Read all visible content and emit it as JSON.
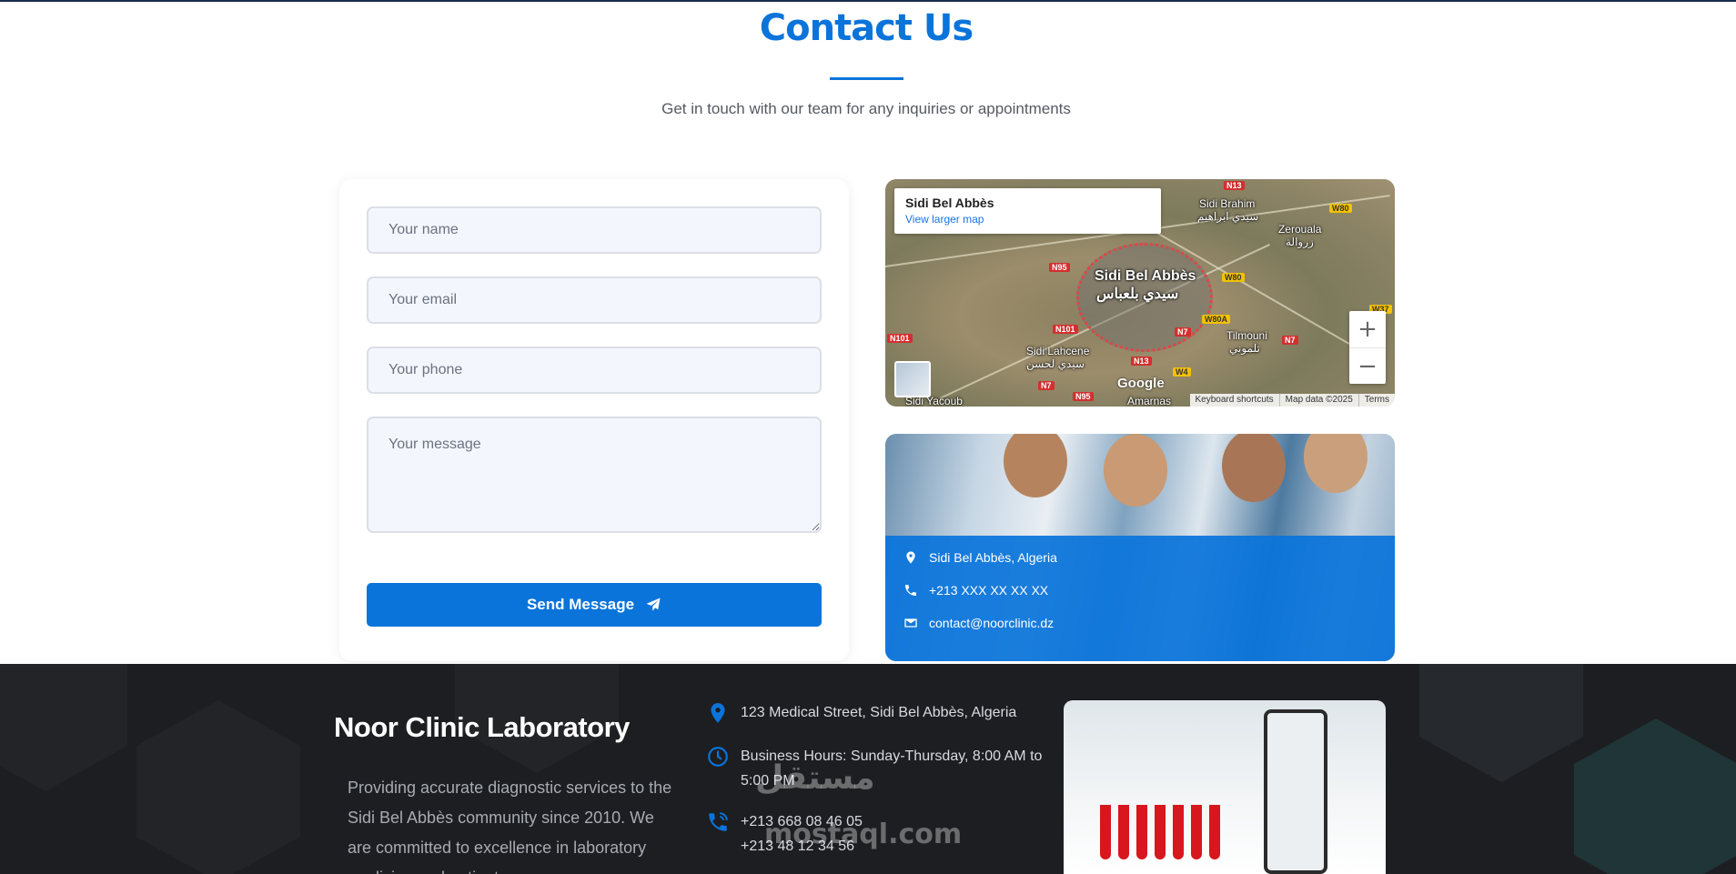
{
  "header": {
    "title": "Contact Us",
    "subtitle": "Get in touch with our team for any inquiries or appointments"
  },
  "form": {
    "name_placeholder": "Your name",
    "email_placeholder": "Your email",
    "phone_placeholder": "Your phone",
    "message_placeholder": "Your message",
    "send_label": "Send Message",
    "send_icon": "paper-plane-icon"
  },
  "map": {
    "place_name": "Sidi Bel Abbès",
    "view_larger": "View larger map",
    "city_label": "Sidi Bel Abbès",
    "city_label_ar": "سيدي بلعباس",
    "labels": {
      "sidi_brahim": "Sidi Brahim",
      "sidi_brahim_ar": "سيدي ابراهيم",
      "zeroua": "Zerouala",
      "zeroua_ar": "زروالة",
      "sidi_lahcene": "Sidi Lahcene",
      "sidi_lahcene_ar": "سيدي لحسن",
      "tilmouni": "Tilmouni",
      "tilmouni_ar": "تلموني",
      "sidi_yacoub": "Sidi Yacoub",
      "amarnas": "Amarnas"
    },
    "roads": [
      "N13",
      "N95",
      "N101",
      "N7",
      "W80",
      "W80A",
      "W4",
      "W37"
    ],
    "zoom_in": "+",
    "zoom_out": "−",
    "google": "Google",
    "footer": {
      "shortcuts": "Keyboard shortcuts",
      "data": "Map data ©2025",
      "terms": "Terms"
    }
  },
  "contact_info": {
    "address": "Sidi Bel Abbès, Algeria",
    "phone": "+213 XXX XX XX XX",
    "email": "contact@noorclinic.dz"
  },
  "footer": {
    "title": "Noor Clinic Laboratory",
    "description": "Providing accurate diagnostic services to the Sidi Bel Abbès community since 2010. We are committed to excellence in laboratory medicine and patient care.",
    "address": "123 Medical Street, Sidi Bel Abbès, Algeria",
    "hours": "Business Hours: Sunday-Thursday, 8:00 AM to 5:00 PM",
    "phone1": "+213 668 08 46 05",
    "phone2": "+213 48 12 34 56"
  },
  "watermark": {
    "arabic": "مستقل",
    "latin": "mostaql.com"
  },
  "colors": {
    "accent": "#0a74da",
    "footer_bg": "#1d1e21"
  }
}
